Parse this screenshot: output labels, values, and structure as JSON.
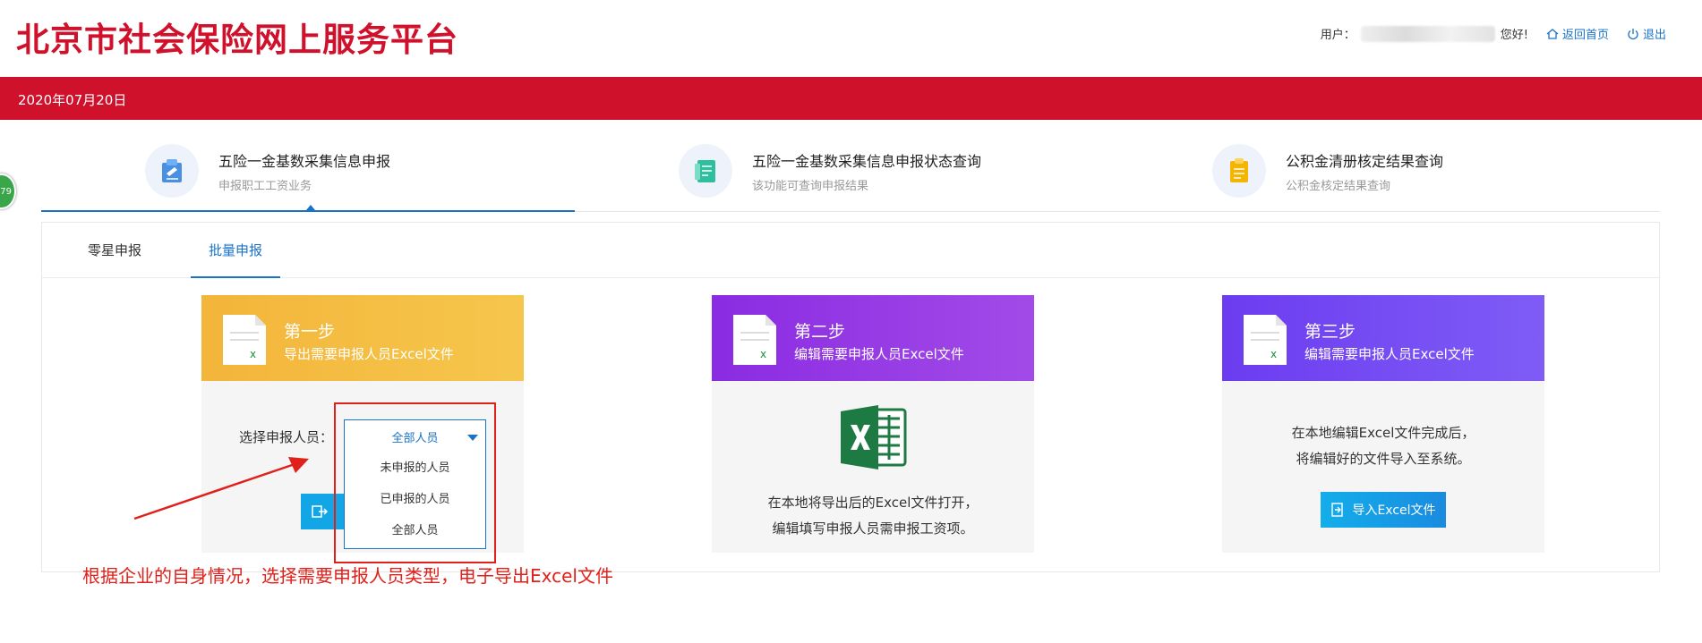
{
  "header": {
    "title": "北京市社会保险网上服务平台",
    "user_prefix": "用户：",
    "greeting": "您好!",
    "home_link": "返回首页",
    "logout_link": "退出"
  },
  "redbar": {
    "date": "2020年07月20日"
  },
  "feature_nav": {
    "items": [
      {
        "title": "五险一金基数采集信息申报",
        "subtitle": "申报职工工资业务"
      },
      {
        "title": "五险一金基数采集信息申报状态查询",
        "subtitle": "该功能可查询申报结果"
      },
      {
        "title": "公积金清册核定结果查询",
        "subtitle": "公积金核定结果查询"
      }
    ]
  },
  "side_badge": "79",
  "tabs": [
    {
      "label": "零星申报"
    },
    {
      "label": "批量申报"
    }
  ],
  "steps": [
    {
      "title": "第一步",
      "desc": "导出需要申报人员Excel文件"
    },
    {
      "title": "第二步",
      "desc": "编辑需要申报人员Excel文件"
    },
    {
      "title": "第三步",
      "desc": "编辑需要申报人员Excel文件"
    }
  ],
  "step1": {
    "select_label": "选择申报人员：",
    "selected": "全部人员",
    "options": [
      "未申报的人员",
      "已申报的人员",
      "全部人员"
    ]
  },
  "step2": {
    "line1": "在本地将导出后的Excel文件打开，",
    "line2": "编辑填写申报人员需申报工资项。"
  },
  "step3": {
    "line1": "在本地编辑Excel文件完成后，",
    "line2": "将编辑好的文件导入至系统。",
    "import_label": "导入Excel文件"
  },
  "annotation": "根据企业的自身情况，选择需要申报人员类型，电子导出Excel文件",
  "colors": {
    "brand_red": "#d0112b",
    "link_blue": "#1a73c9",
    "step1": "#f3b53a",
    "step2": "#8a2be2",
    "step3": "#6c3cf0",
    "annotation_red": "#e0211b"
  }
}
